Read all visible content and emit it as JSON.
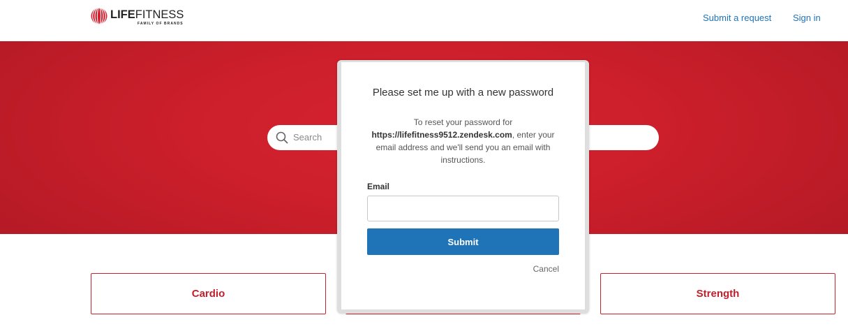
{
  "header": {
    "logo": {
      "brand_bold": "LIFE",
      "brand_light": "FITNESS",
      "tagline": "FAMILY OF BRANDS",
      "icon": "logo-icon"
    },
    "nav": {
      "submit_request": "Submit a request",
      "sign_in": "Sign in"
    }
  },
  "hero": {
    "search": {
      "placeholder": "Search",
      "icon": "search-icon"
    }
  },
  "categories": [
    {
      "label": "Cardio"
    },
    {},
    {
      "label": "Strength"
    }
  ],
  "modal": {
    "title": "Please set me up with a new password",
    "intro_prefix": "To reset your password for",
    "intro_url": "https://lifefitness9512.zendesk.com",
    "intro_suffix": ", enter your email address and we'll send you an email with instructions.",
    "email_label": "Email",
    "email_value": "",
    "submit_label": "Submit",
    "cancel_label": "Cancel"
  },
  "colors": {
    "brand_red": "#cc1f2b",
    "link_blue": "#1f73b7",
    "button_blue": "#1f73b7"
  }
}
